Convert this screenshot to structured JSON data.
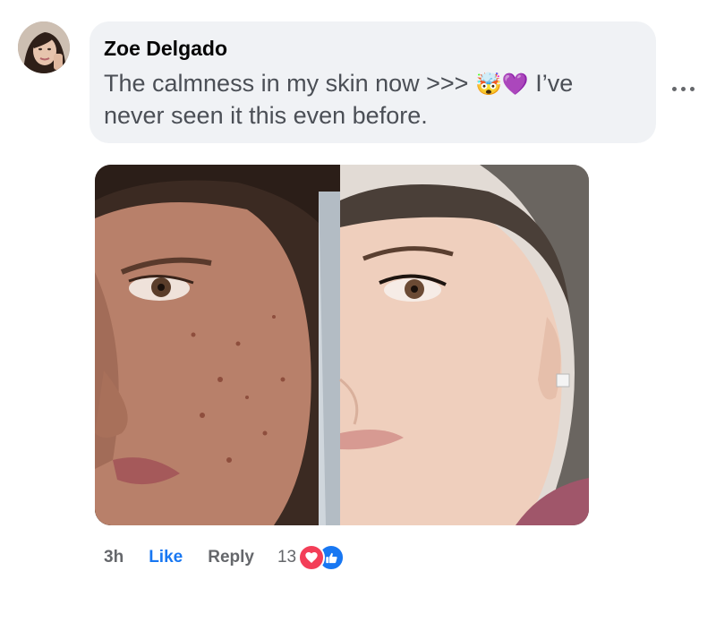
{
  "comment": {
    "author": "Zoe Delgado",
    "text_line1": "The calmness in my skin now >>> ",
    "emojis": [
      "🤯",
      "💜"
    ],
    "text_after_emoji": " I’ve",
    "text_line2": "never seen it this even before."
  },
  "actions": {
    "time": "3h",
    "like_label": "Like",
    "reply_label": "Reply",
    "reaction_count": "13",
    "reactions": [
      "love-reaction",
      "like-reaction"
    ]
  },
  "icons": {
    "more": "more-options-icon",
    "love": "heart-icon",
    "like": "thumbs-up-icon"
  },
  "colors": {
    "link_blue": "#1877f2",
    "bubble_bg": "#f0f2f5",
    "love_red": "#f33e58",
    "secondary_text": "#65676b"
  }
}
